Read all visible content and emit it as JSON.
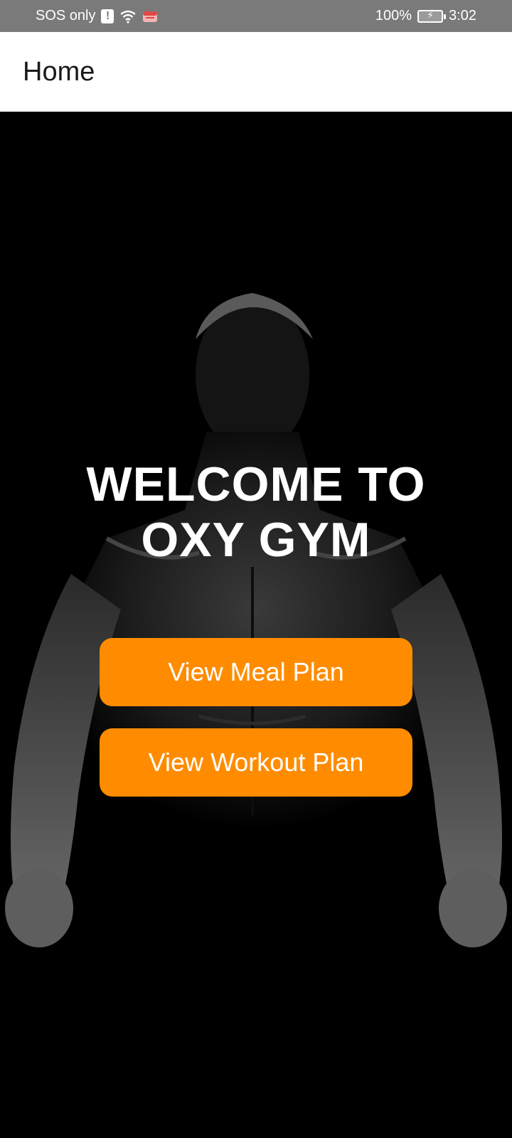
{
  "status_bar": {
    "carrier": "SOS only",
    "battery": "100%",
    "time": "3:02"
  },
  "app_bar": {
    "title": "Home"
  },
  "hero": {
    "welcome_line1": "WELCOME TO",
    "welcome_line2": "OXY GYM",
    "meal_button": "View Meal Plan",
    "workout_button": "View Workout Plan",
    "accent_color": "#ff8c00"
  },
  "icons": [
    "alert-icon",
    "wifi-icon",
    "notification-icon",
    "battery-icon"
  ]
}
